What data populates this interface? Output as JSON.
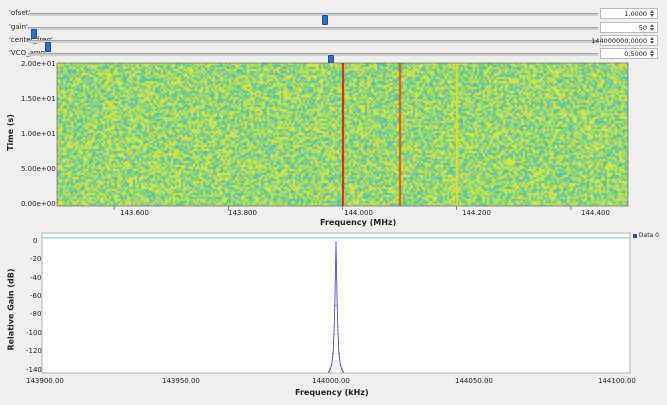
{
  "controls": [
    {
      "label": "'ofset'",
      "value": "1,0000",
      "position": 0.52
    },
    {
      "label": "'gain'",
      "value": "50",
      "position": 0.005
    },
    {
      "label": "'center_freq'",
      "value": "144000000,0000",
      "position": 0.03
    },
    {
      "label": "'VCO_amp'",
      "value": "0,5000",
      "position": 0.53
    }
  ],
  "waterfall": {
    "ylabel": "Time (s)",
    "xlabel": "Frequency (MHz)",
    "y_ticks": [
      "2.00e+01",
      "1.50e+01",
      "1.00e+01",
      "5.00e+00",
      "0.00e+00"
    ],
    "x_ticks": [
      "143.600",
      "143.800",
      "144.000",
      "144.200",
      "144.400"
    ]
  },
  "spectrum": {
    "ylabel": "Relative Gain (dB)",
    "xlabel": "Frequency (kHz)",
    "y_ticks": [
      "0",
      "-20",
      "-40",
      "-60",
      "-80",
      "-100",
      "-120",
      "-140"
    ],
    "x_ticks": [
      "143900.00",
      "143950.00",
      "144000.00",
      "144050.00",
      "144100.00"
    ],
    "legend": "Data 0"
  },
  "chart_data": [
    {
      "type": "heatmap",
      "xlabel": "Frequency (MHz)",
      "ylabel": "Time (s)",
      "xlim": [
        143.5,
        144.5
      ],
      "ylim": [
        0,
        20
      ],
      "signal_lines": [
        {
          "freq": 144.0,
          "color": "#e02000"
        },
        {
          "freq": 144.1,
          "color": "#f05000"
        },
        {
          "freq": 144.2,
          "color": "#e0e020"
        }
      ],
      "colors": {
        "background": "#7fd28a",
        "noise": "#c8e64a"
      }
    },
    {
      "type": "line",
      "xlabel": "Frequency (kHz)",
      "ylabel": "Relative Gain (dB)",
      "xlim": [
        143900,
        144100
      ],
      "ylim": [
        -140,
        5
      ],
      "series": [
        {
          "name": "Data 0",
          "color": "#3a3acc",
          "x": [
            143997.5,
            143998.0,
            143998.5,
            143999.0,
            143999.3,
            143999.6,
            144000.0,
            144000.4,
            144000.7,
            144001.0,
            144001.5,
            144002.0,
            144002.5
          ],
          "y": [
            -139,
            -136,
            -132,
            -120,
            -100,
            -70,
            -5,
            -70,
            -100,
            -120,
            -132,
            -136,
            -139
          ]
        }
      ],
      "reference_line": 0
    }
  ]
}
